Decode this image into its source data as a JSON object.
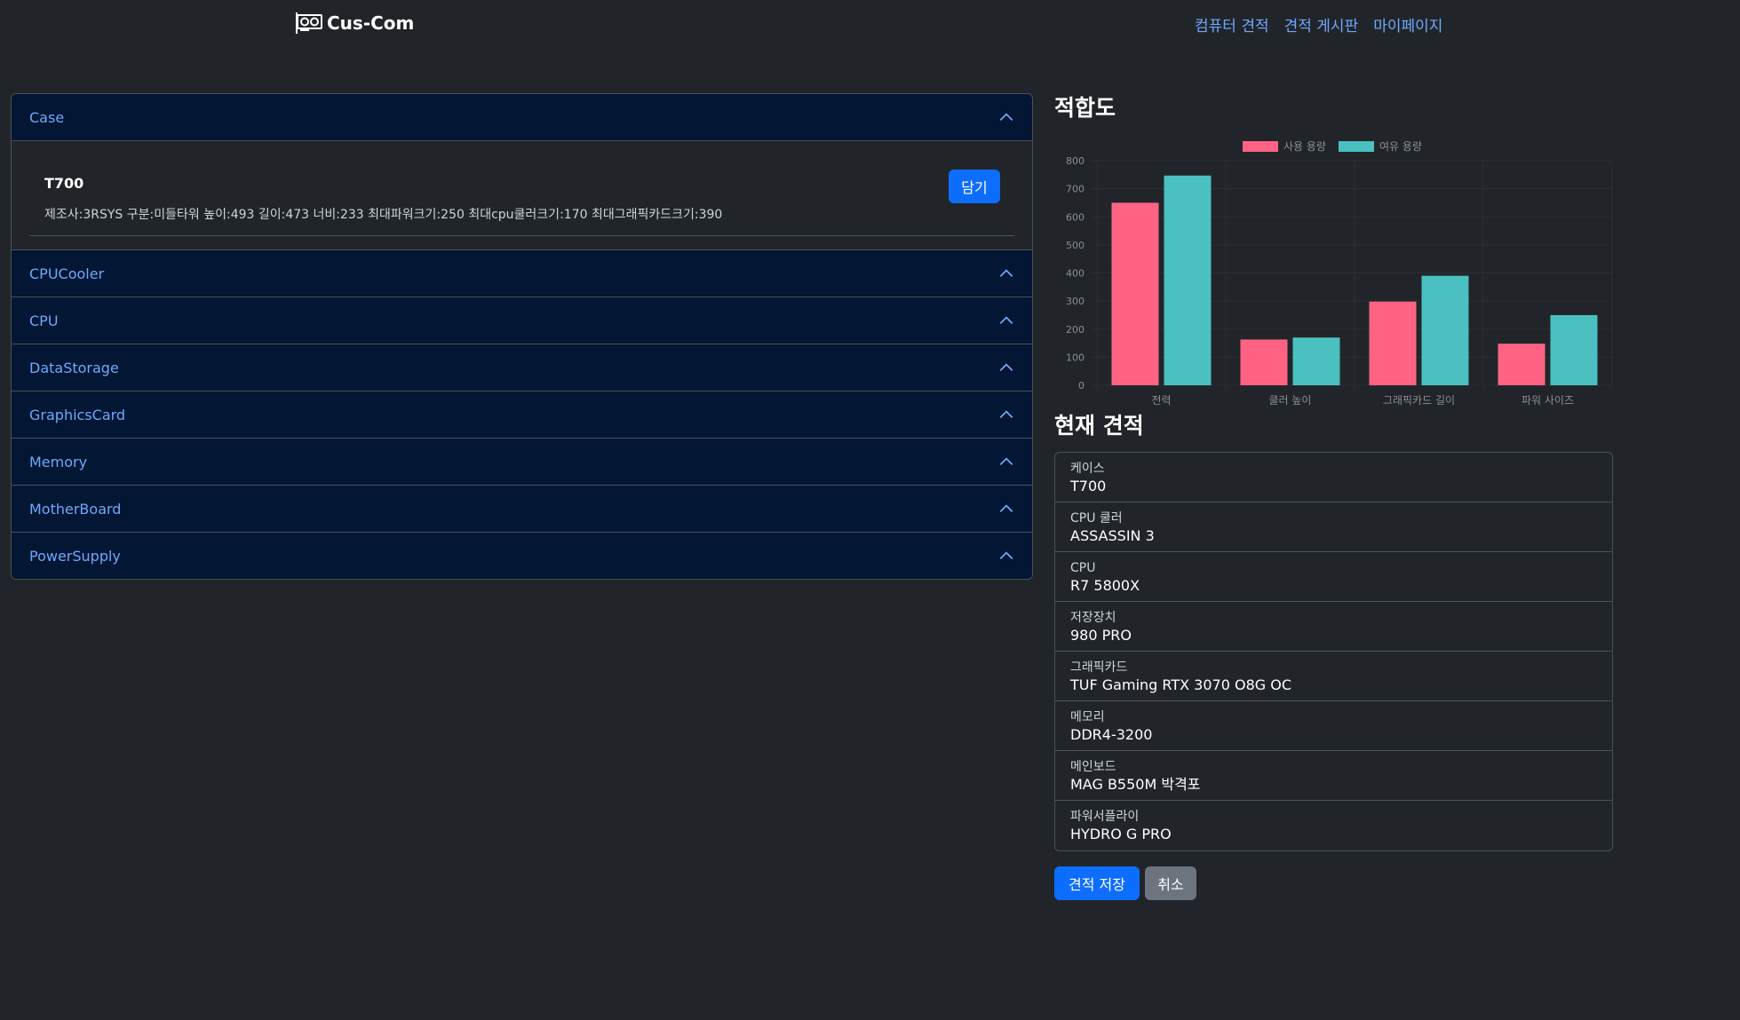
{
  "navbar": {
    "brand": "Cus-Com",
    "links": [
      "컴퓨터 견적",
      "견적 게시판",
      "마이페이지"
    ]
  },
  "accordion": {
    "categories": [
      "Case",
      "CPUCooler",
      "CPU",
      "DataStorage",
      "GraphicsCard",
      "Memory",
      "MotherBoard",
      "PowerSupply"
    ],
    "open_item": {
      "name": "T700",
      "spec": "제조사:3RSYS 구분:미들타워 높이:493 길이:473 너비:233 최대파워크기:250 최대cpu쿨러크기:170 최대그래픽카드크기:390",
      "button_label": "담기"
    }
  },
  "compat": {
    "title": "적합도"
  },
  "chart_data": {
    "type": "bar",
    "categories": [
      "전력",
      "쿨러 높이",
      "그래픽카드 길이",
      "파워 사이즈"
    ],
    "series": [
      {
        "name": "사용 용량",
        "values": [
          650,
          163,
          298,
          148
        ],
        "color": "#ff6384"
      },
      {
        "name": "여유 용량",
        "values": [
          747,
          170,
          390,
          250
        ],
        "color": "#4bc0c0"
      }
    ],
    "yticks": [
      0,
      100,
      200,
      300,
      400,
      500,
      600,
      700,
      800
    ],
    "ylim": [
      0,
      800
    ],
    "legend": "top-center",
    "grid": true
  },
  "estimate": {
    "title": "현재 견적",
    "items": [
      {
        "label": "케이스",
        "value": "T700"
      },
      {
        "label": "CPU 쿨러",
        "value": "ASSASSIN 3"
      },
      {
        "label": "CPU",
        "value": "R7 5800X"
      },
      {
        "label": "저장장치",
        "value": "980 PRO"
      },
      {
        "label": "그래픽카드",
        "value": "TUF Gaming RTX 3070 O8G OC"
      },
      {
        "label": "메모리",
        "value": "DDR4-3200"
      },
      {
        "label": "메인보드",
        "value": "MAG B550M 박격포"
      },
      {
        "label": "파워서플라이",
        "value": "HYDRO G PRO"
      }
    ],
    "save_label": "견적 저장",
    "cancel_label": "취소"
  },
  "colors": {
    "background": "#212529",
    "accordion_header": "#031633",
    "link": "#6ea8fe",
    "primary": "#0d6efd",
    "secondary": "#6c757d"
  }
}
